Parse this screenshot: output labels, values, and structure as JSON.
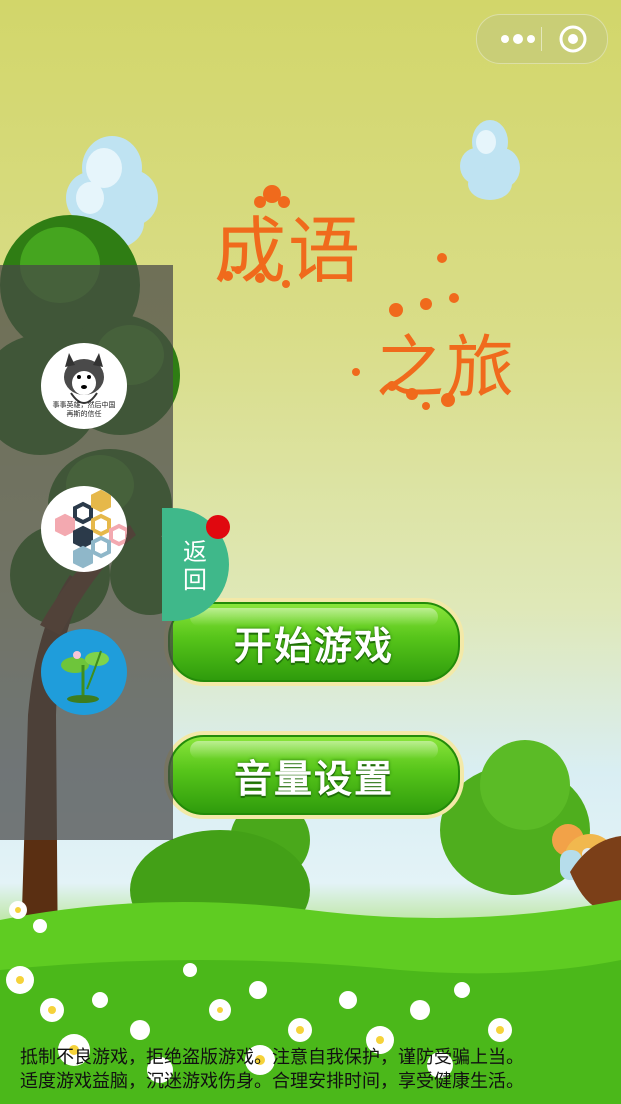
{
  "capsule": {
    "menu_icon": "more-dots-icon",
    "close_icon": "target-circle-icon"
  },
  "title": {
    "line1": "成语",
    "line2": "之旅"
  },
  "side_panel": {
    "apps": [
      {
        "name": "husky-app",
        "icon": "husky-dog-icon",
        "caption": "事事英雄, 然后中国 再斯的信任"
      },
      {
        "name": "hexagon-puzzle-app",
        "icon": "hexagon-puzzle-icon"
      },
      {
        "name": "lotus-app",
        "icon": "lotus-frog-icon"
      }
    ]
  },
  "back_tab": {
    "label": "返\n回",
    "badge_color": "#e0080f"
  },
  "buttons": {
    "start": "开始游戏",
    "volume": "音量设置"
  },
  "notice": {
    "line1": "抵制不良游戏，拒绝盗版游戏。注意自我保护，谨防受骗上当。",
    "line2": "适度游戏益脑，沉迷游戏伤身。合理安排时间，享受健康生活。"
  },
  "colors": {
    "accent_orange": "#f06a1c",
    "button_green": "#56c41a",
    "panel": "#464646"
  }
}
